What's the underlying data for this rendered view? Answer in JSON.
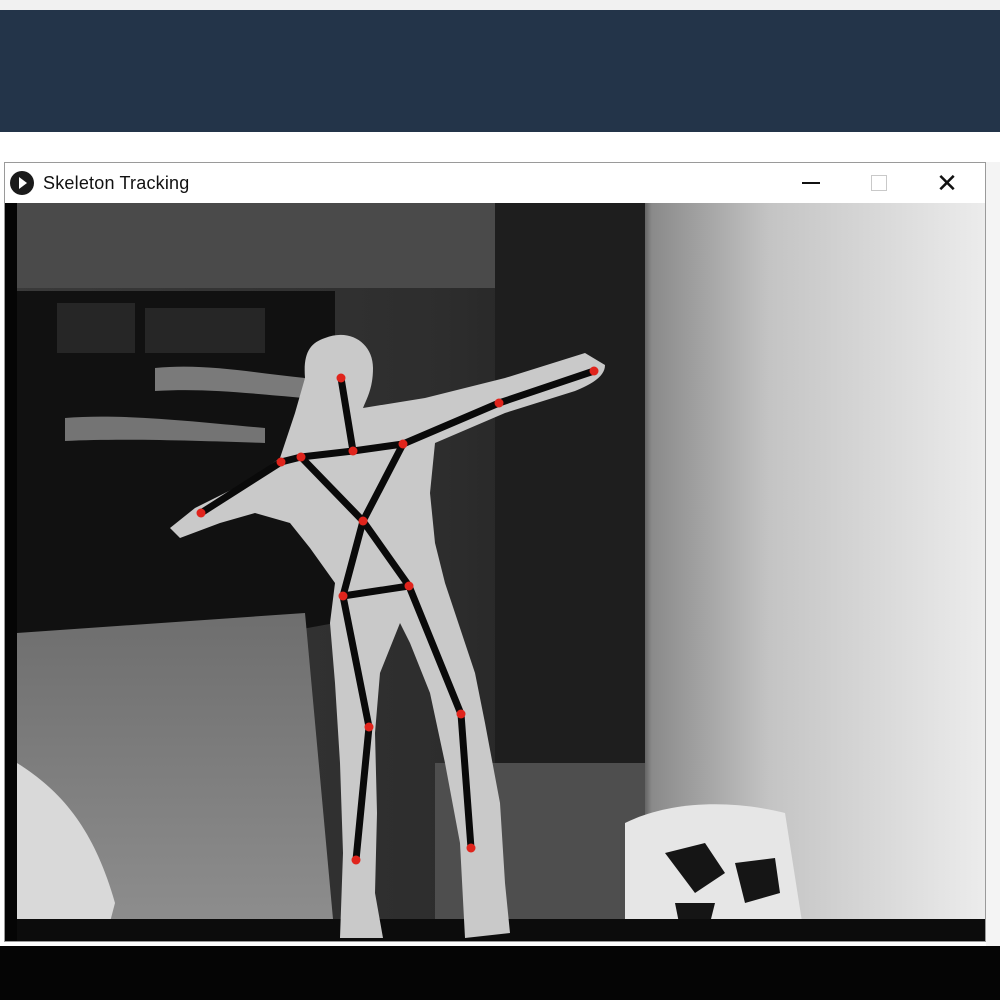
{
  "window": {
    "title": "Skeleton Tracking",
    "icon": "processing-play-icon",
    "controls": [
      "minimize-icon",
      "maximize-icon",
      "close-icon"
    ]
  },
  "colors": {
    "header_band": "#233449",
    "joint": "#e0241c",
    "bone": "#0a0a0a",
    "body_depth": "#c9c9c9"
  },
  "skeleton": {
    "joints": [
      {
        "name": "head"
      },
      {
        "name": "neck"
      },
      {
        "name": "shoulder-left"
      },
      {
        "name": "elbow-left"
      },
      {
        "name": "hand-left"
      },
      {
        "name": "shoulder-right"
      },
      {
        "name": "elbow-right"
      },
      {
        "name": "hand-right"
      },
      {
        "name": "torso"
      },
      {
        "name": "hip-left"
      },
      {
        "name": "hip-right"
      },
      {
        "name": "knee-left"
      },
      {
        "name": "knee-right"
      },
      {
        "name": "foot-left"
      },
      {
        "name": "foot-right"
      }
    ],
    "bones": [
      [
        "head",
        "neck"
      ],
      [
        "neck",
        "shoulder-left"
      ],
      [
        "neck",
        "shoulder-right"
      ],
      [
        "shoulder-left",
        "elbow-left"
      ],
      [
        "elbow-left",
        "hand-left"
      ],
      [
        "shoulder-right",
        "elbow-right"
      ],
      [
        "elbow-right",
        "hand-right"
      ],
      [
        "shoulder-left",
        "torso"
      ],
      [
        "shoulder-right",
        "torso"
      ],
      [
        "torso",
        "hip-left"
      ],
      [
        "torso",
        "hip-right"
      ],
      [
        "hip-left",
        "hip-right"
      ],
      [
        "hip-left",
        "knee-left"
      ],
      [
        "knee-left",
        "foot-left"
      ],
      [
        "hip-right",
        "knee-right"
      ],
      [
        "knee-right",
        "foot-right"
      ]
    ]
  }
}
